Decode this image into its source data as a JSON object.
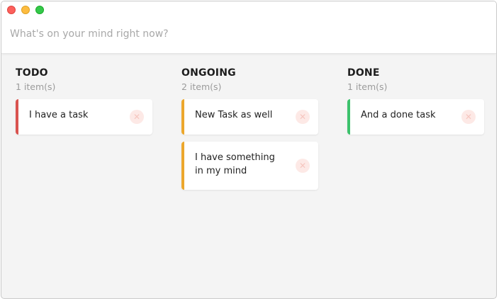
{
  "input": {
    "placeholder": "What's on your mind right now?"
  },
  "columns": [
    {
      "title": "TODO",
      "count": "1 item(s)",
      "color": "#d9534f",
      "cards": [
        {
          "text": "I have a task"
        }
      ]
    },
    {
      "title": "ONGOING",
      "count": "2 item(s)",
      "color": "#eca72c",
      "cards": [
        {
          "text": "New Task as well"
        },
        {
          "text": "I have something in my mind"
        }
      ]
    },
    {
      "title": "DONE",
      "count": "1 item(s)",
      "color": "#3cc26c",
      "cards": [
        {
          "text": "And a done task"
        }
      ]
    }
  ],
  "icons": {
    "delete": "close-circle-icon",
    "delete_glyph": "✕"
  }
}
